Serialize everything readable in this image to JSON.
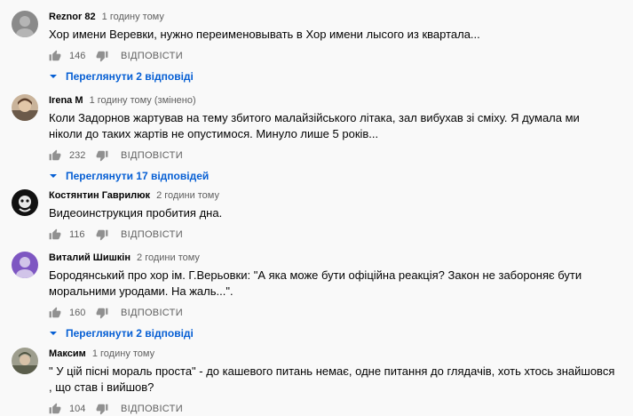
{
  "reply_label": "ВІДПОВІСТИ",
  "colors": {
    "link": "#065fd4",
    "meta": "#606060",
    "text": "#030303"
  },
  "comments": [
    {
      "author": "Reznor 82",
      "time": "1 годину тому",
      "text": "Хор имени Веревки, нужно переименовывать в Хор имени лысого из квартала...",
      "likes": "146",
      "replies_label": "Переглянути 2 відповіді",
      "avatar": "gray-avatar"
    },
    {
      "author": "Irena M",
      "time": "1 годину тому (змінено)",
      "text": "Коли Задорнов жартував на тему збитого малайзійського літака, зал вибухав зі сміху. Я думала ми ніколи до таких жартів не опустимося. Минуло лише 5 років...",
      "likes": "232",
      "replies_label": "Переглянути 17 відповідей",
      "avatar": "photo-avatar"
    },
    {
      "author": "Костянтин Гаврилюк",
      "time": "2 години тому",
      "text": "Видеоинструкция пробития дна.",
      "likes": "116",
      "replies_label": "",
      "avatar": "dark-avatar"
    },
    {
      "author": "Виталий Шишкін",
      "time": "2 години тому",
      "text": "Бородянський про хор ім. Г.Верьовки: \"А яка може бути офіційна реакція? Закон не забороняє бути моральними уродами. На жаль...\".",
      "likes": "160",
      "replies_label": "Переглянути 2 відповіді",
      "avatar": "purple-letter-avatar"
    },
    {
      "author": "Максим",
      "time": "1 годину тому",
      "text": "\" У цій пісні мораль проста\" -  до кашевого  питань немає, одне питання до глядачів, хоть хтось знайшовся , що став і вийшов?",
      "likes": "104",
      "replies_label": "",
      "avatar": "soldier-photo-avatar"
    }
  ]
}
